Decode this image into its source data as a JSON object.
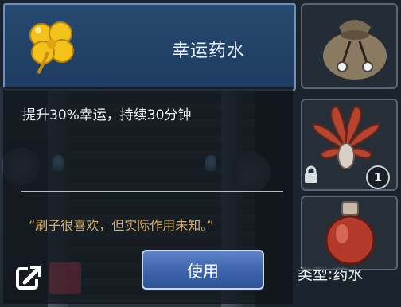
{
  "dialog": {
    "title": "幸运药水",
    "description": "提升30%幸运，持续30分钟",
    "flavor_text": "“刷子很喜欢，但实际作用未知。”",
    "use_button": "使用",
    "type_label": "类型:药水"
  },
  "inventory": {
    "slot_badge_count": "1"
  },
  "colors": {
    "header_blue": "#27486f",
    "title_text": "#e9f2ff",
    "flavor_gold": "#d6b36b",
    "button_blue": "#3c63ab",
    "clover_yellow": "#f2c21b"
  }
}
